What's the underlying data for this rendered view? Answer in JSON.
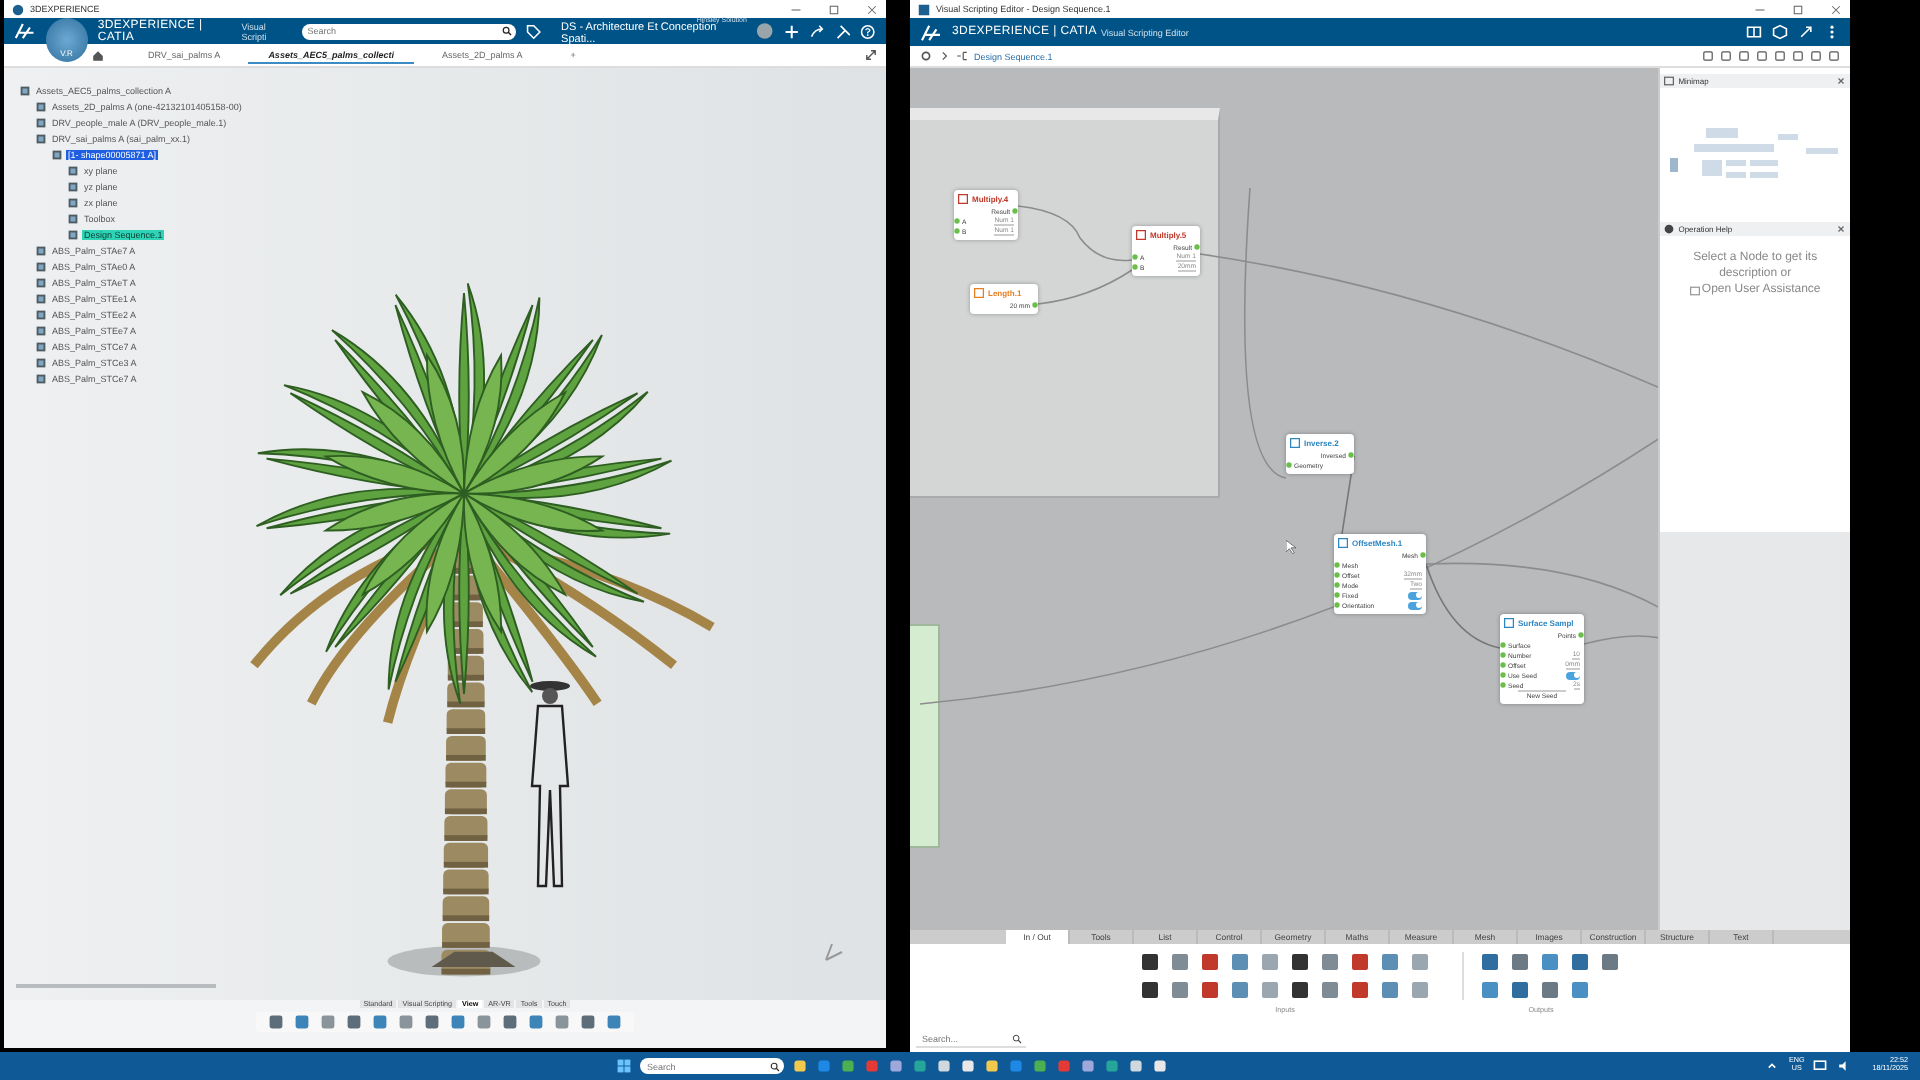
{
  "left_window": {
    "title": "3DEXPERIENCE",
    "app_bar": {
      "brand": "3DEXPERIENCE | CATIA",
      "app": "Visual Scripti",
      "compass": "V.R",
      "search": {
        "placeholder": "Search"
      },
      "tenant": "Hinsley Solution",
      "collab_space": "DS - Architecture Et Conception Spati..."
    },
    "tabs": [
      {
        "label": "DRV_sai_palms A",
        "selected": false
      },
      {
        "label": "Assets_AEC5_palms_collecti",
        "selected": true
      },
      {
        "label": "Assets_2D_palms A",
        "selected": false
      },
      {
        "label": "+",
        "selected": false
      }
    ],
    "tree": [
      {
        "label": "Assets_AEC5_palms_collection A",
        "selected": false,
        "active": false,
        "children": [
          {
            "label": "Assets_2D_palms A (one-42132101405158-00)",
            "selected": false,
            "active": false
          },
          {
            "label": "DRV_people_male A (DRV_people_male.1)",
            "selected": false,
            "active": false
          },
          {
            "label": "DRV_sai_palms A (sai_palm_xx.1)",
            "selected": false,
            "active": false,
            "children": [
              {
                "label": "[1- shape00005871 A]",
                "selected": true,
                "active": false,
                "children": [
                  {
                    "label": "xy plane",
                    "selected": false,
                    "active": false
                  },
                  {
                    "label": "yz plane",
                    "selected": false,
                    "active": false
                  },
                  {
                    "label": "zx plane",
                    "selected": false,
                    "active": false
                  },
                  {
                    "label": "Toolbox",
                    "selected": false,
                    "active": false
                  },
                  {
                    "label": "Design Sequence.1",
                    "selected": false,
                    "active": true
                  }
                ]
              }
            ]
          },
          {
            "label": "ABS_Palm_STAe7 A",
            "selected": false,
            "active": false
          },
          {
            "label": "ABS_Palm_STAe0 A",
            "selected": false,
            "active": false
          },
          {
            "label": "ABS_Palm_STAeT A",
            "selected": false,
            "active": false
          },
          {
            "label": "ABS_Palm_STEe1 A",
            "selected": false,
            "active": false
          },
          {
            "label": "ABS_Palm_STEe2 A",
            "selected": false,
            "active": false
          },
          {
            "label": "ABS_Palm_STEe7 A",
            "selected": false,
            "active": false
          },
          {
            "label": "ABS_Palm_STCe7 A",
            "selected": false,
            "active": false
          },
          {
            "label": "ABS_Palm_STCe3 A",
            "selected": false,
            "active": false
          },
          {
            "label": "ABS_Palm_STCe7 A",
            "selected": false,
            "active": false
          }
        ]
      }
    ],
    "toolbar_tabs": [
      {
        "label": "Standard",
        "selected": false
      },
      {
        "label": "Visual Scripting",
        "selected": false
      },
      {
        "label": "View",
        "selected": true
      },
      {
        "label": "AR-VR",
        "selected": false
      },
      {
        "label": "Tools",
        "selected": false
      },
      {
        "label": "Touch",
        "selected": false
      }
    ]
  },
  "right_window": {
    "title": "Visual Scripting Editor - Design Sequence.1",
    "header": {
      "brand": "3DEXPERIENCE | CATIA",
      "app": "Visual Scripting Editor"
    },
    "breadcrumb": "Design Sequence.1",
    "nodes": [
      {
        "title": "Multiply.4",
        "color": "#c0392b",
        "ports": [
          {
            "kind": "out",
            "label": "Result"
          },
          {
            "kind": "in",
            "label": "A",
            "value": "Num 1"
          },
          {
            "kind": "in",
            "label": "B",
            "value": "Num 1"
          }
        ]
      },
      {
        "title": "Multiply.5",
        "color": "#c0392b",
        "ports": [
          {
            "kind": "out",
            "label": "Result"
          },
          {
            "kind": "in",
            "label": "A",
            "value": "Num 1"
          },
          {
            "kind": "in",
            "label": "B",
            "value": "20mm"
          }
        ]
      },
      {
        "title": "Length.1",
        "color": "#e67e22",
        "ports": [
          {
            "kind": "out",
            "label": "20 mm"
          }
        ]
      },
      {
        "title": "Inverse.2",
        "color": "#2e86c1",
        "ports": [
          {
            "kind": "out",
            "label": "Inversed"
          },
          {
            "kind": "in",
            "label": "Geometry"
          }
        ]
      },
      {
        "title": "OffsetMesh.1",
        "color": "#2e86c1",
        "ports": [
          {
            "kind": "out",
            "label": "Mesh"
          },
          {
            "kind": "in",
            "label": "Mesh"
          },
          {
            "kind": "in",
            "label": "Offset",
            "value": "32mm"
          },
          {
            "kind": "in",
            "label": "Mode",
            "value": "Two"
          },
          {
            "kind": "toggle",
            "label": "Fixed",
            "on": true
          },
          {
            "kind": "toggle",
            "label": "Orientation",
            "on": true
          }
        ]
      },
      {
        "title": "Surface Sampl",
        "color": "#2e86c1",
        "ports": [
          {
            "kind": "out",
            "label": "Points"
          },
          {
            "kind": "in",
            "label": "Surface"
          },
          {
            "kind": "in",
            "label": "Number",
            "value": "10"
          },
          {
            "kind": "in",
            "label": "Offset",
            "value": "0mm"
          },
          {
            "kind": "toggle",
            "label": "Use Seed",
            "on": true
          },
          {
            "kind": "in",
            "label": "Seed",
            "value": "2s"
          },
          {
            "kind": "button",
            "label": "New Seed"
          }
        ]
      }
    ],
    "minimap": {
      "title": "Minimap"
    },
    "operation_help": {
      "title": "Operation Help",
      "text": "Select a Node to get its description or",
      "link": "Open User Assistance"
    },
    "palette_tabs": [
      {
        "label": "In / Out",
        "selected": true
      },
      {
        "label": "Tools",
        "selected": false
      },
      {
        "label": "List",
        "selected": false
      },
      {
        "label": "Control",
        "selected": false
      },
      {
        "label": "Geometry",
        "selected": false
      },
      {
        "label": "Maths",
        "selected": false
      },
      {
        "label": "Measure",
        "selected": false
      },
      {
        "label": "Mesh",
        "selected": false
      },
      {
        "label": "Images",
        "selected": false
      },
      {
        "label": "Construction",
        "selected": false
      },
      {
        "label": "Structure",
        "selected": false
      },
      {
        "label": "Text",
        "selected": false
      }
    ],
    "palette_groups": [
      "Inputs",
      "Outputs"
    ],
    "search": {
      "placeholder": "Search..."
    }
  },
  "taskbar": {
    "search": {
      "placeholder": "Search"
    },
    "language": "ENG",
    "region": "US",
    "time": "22:52",
    "date": "18/11/2025"
  }
}
